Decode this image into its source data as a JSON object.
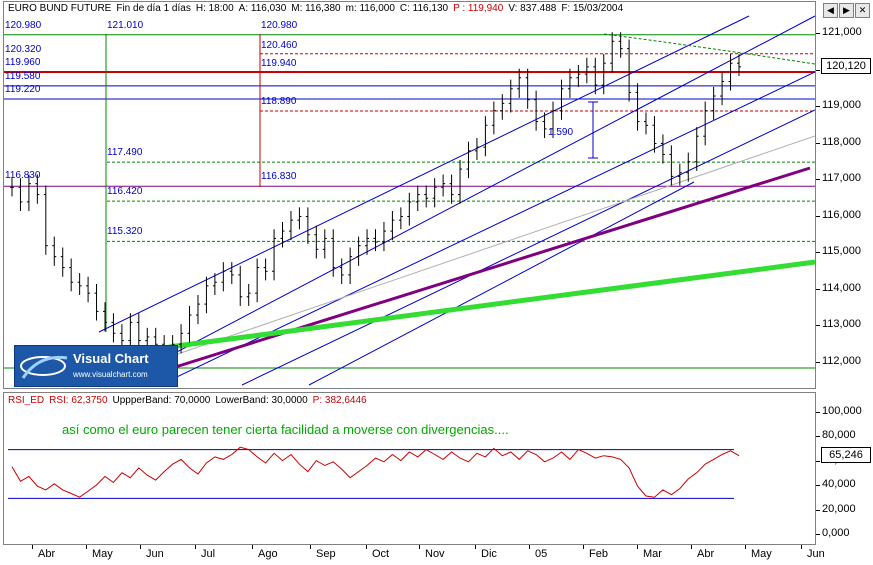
{
  "header": {
    "symbol": "EURO BUND FUTURE",
    "period": "Fin de día 1 días",
    "hour": "H: 18:00",
    "open": "A: 116,030",
    "high": "M: 116,380",
    "low": "m: 116,000",
    "close": "C: 116,130",
    "price": "P : 119,940",
    "volume": "V: 837.488",
    "date": "F: 15/03/2004"
  },
  "rsi_header": {
    "name": "RSI_ED",
    "value": "RSI: 62,3750",
    "upper": "UppperBand: 70,0000",
    "lower": "LowerBand: 30,0000",
    "p": "P: 382,6446"
  },
  "annotation": "así como el euro parecen tener cierta facilidad a moverse con divergencias....",
  "levels": {
    "l120980a": "120.980",
    "l121010": "121.010",
    "l120980b": "120.980",
    "l120320": "120.320",
    "l120460": "120.460",
    "l119960": "119.960",
    "l119940": "119.940",
    "l119580": "119.580",
    "l119220": "119.220",
    "l118890": "118.890",
    "l117490": "117.490",
    "l116830a": "116.830",
    "l116420": "116.420",
    "l116830b": "116.830",
    "l115320": "115.320",
    "l1590": "1.590"
  },
  "price_axis": [
    "121,000",
    "120,000",
    "119,000",
    "118,000",
    "117,000",
    "116,000",
    "115,000",
    "114,000",
    "113,000",
    "112,000"
  ],
  "current_price": "120,120",
  "rsi_axis": [
    "100,000",
    "80,000",
    "60,000",
    "40,000",
    "20,000",
    "0,000"
  ],
  "current_rsi": "65,246",
  "months": [
    "Abr",
    "May",
    "Jun",
    "Jul",
    "Ago",
    "Sep",
    "Oct",
    "Nov",
    "Dic",
    "05",
    "Feb",
    "Mar",
    "Abr",
    "May",
    "Jun"
  ],
  "logo": {
    "title": "Visual Chart",
    "url": "www.visualchart.com"
  },
  "colors": {
    "bars": "#000000",
    "channel": "#0000cc",
    "trend_green": "#33dd33",
    "trend_purple": "#800080",
    "rsi": "#cc0000",
    "level_red": "#cc0000",
    "level_green": "#008800"
  },
  "chart_data": [
    {
      "type": "ohlc",
      "title": "EURO BUND FUTURE",
      "ylim": [
        111.5,
        121.6
      ],
      "series_close": [
        116.8,
        116.4,
        116.9,
        116.6,
        115.2,
        114.9,
        114.6,
        114.2,
        114.1,
        113.9,
        113.4,
        113.1,
        112.8,
        112.6,
        113.1,
        112.6,
        112.7,
        112.5,
        112.1,
        112.5,
        112.8,
        113.3,
        113.6,
        114.1,
        114.2,
        114.5,
        114.4,
        113.8,
        113.9,
        114.6,
        114.5,
        115.4,
        115.6,
        115.9,
        116.0,
        115.5,
        115.1,
        115.4,
        114.6,
        114.4,
        114.9,
        115.2,
        115.4,
        115.3,
        115.6,
        115.9,
        116.0,
        116.4,
        116.6,
        116.5,
        116.8,
        116.9,
        116.6,
        117.3,
        117.8,
        117.9,
        118.5,
        118.9,
        119.1,
        119.5,
        119.8,
        119.2,
        118.6,
        118.4,
        118.9,
        119.5,
        119.8,
        119.9,
        120.1,
        119.6,
        120.2,
        120.8,
        120.6,
        119.4,
        118.6,
        118.5,
        118.0,
        117.7,
        117.1,
        117.2,
        117.5,
        118.2,
        118.9,
        119.3,
        119.7,
        120.2,
        120.1
      ]
    },
    {
      "type": "line",
      "title": "RSI_ED",
      "ylim": [
        0,
        100
      ],
      "upper_band": 70,
      "lower_band": 30,
      "values": [
        56,
        44,
        48,
        40,
        37,
        42,
        37,
        34,
        31,
        36,
        41,
        48,
        43,
        51,
        47,
        55,
        49,
        45,
        52,
        58,
        62,
        55,
        50,
        59,
        64,
        62,
        66,
        72,
        70,
        64,
        59,
        67,
        61,
        66,
        58,
        52,
        61,
        57,
        60,
        54,
        47,
        52,
        57,
        63,
        60,
        66,
        61,
        68,
        64,
        70,
        66,
        62,
        68,
        63,
        60,
        67,
        64,
        71,
        65,
        68,
        62,
        69,
        66,
        60,
        63,
        68,
        62,
        70,
        67,
        63,
        65,
        64,
        62,
        55,
        40,
        32,
        31,
        37,
        33,
        38,
        46,
        51,
        58,
        62,
        66,
        69,
        65
      ]
    }
  ]
}
